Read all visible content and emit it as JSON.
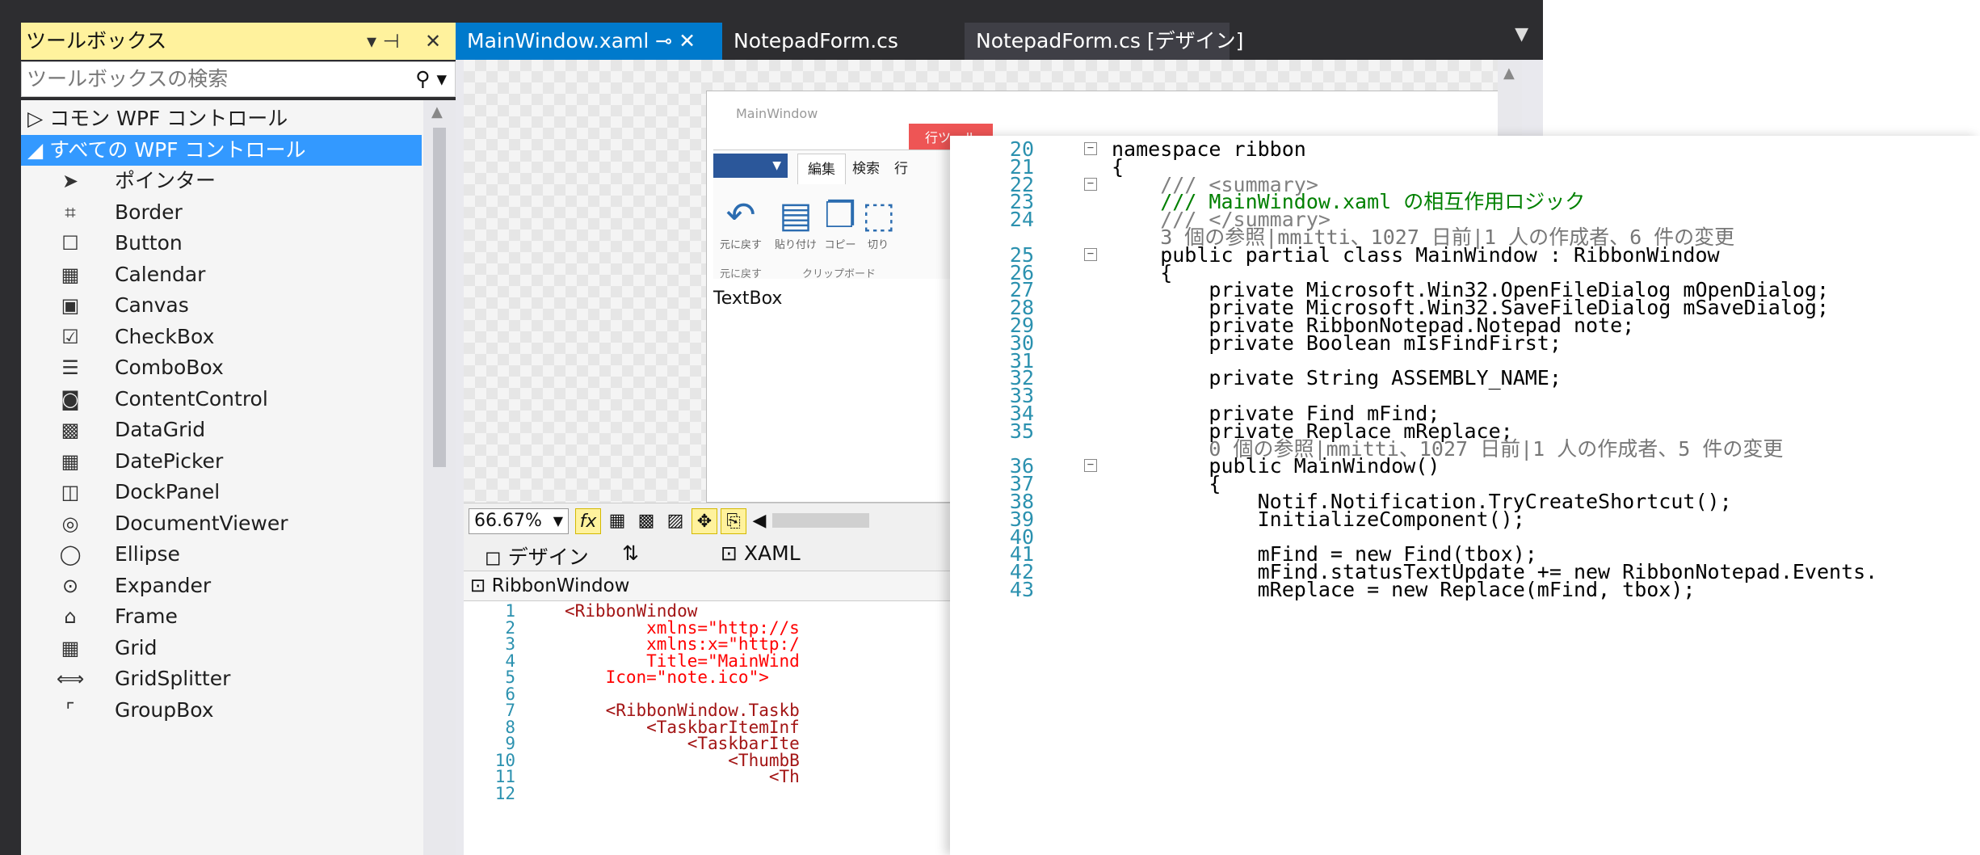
{
  "toolbox": {
    "title": "ツールボックス",
    "pin": "▾ 𝟏",
    "close": "✕",
    "search_placeholder": "ツールボックスの検索",
    "items": [
      {
        "label": "▷ コモン WPF コントロール",
        "icon": "",
        "category": true
      },
      {
        "label": "◢ すべての WPF コントロール",
        "icon": "",
        "category": true,
        "selected": true
      },
      {
        "label": "ポインター",
        "icon": "pointer-icon"
      },
      {
        "label": "Border",
        "icon": "border-icon"
      },
      {
        "label": "Button",
        "icon": "button-icon"
      },
      {
        "label": "Calendar",
        "icon": "calendar-icon"
      },
      {
        "label": "Canvas",
        "icon": "canvas-icon"
      },
      {
        "label": "CheckBox",
        "icon": "checkbox-icon"
      },
      {
        "label": "ComboBox",
        "icon": "combobox-icon"
      },
      {
        "label": "ContentControl",
        "icon": "contentcontrol-icon"
      },
      {
        "label": "DataGrid",
        "icon": "datagrid-icon"
      },
      {
        "label": "DatePicker",
        "icon": "datepicker-icon"
      },
      {
        "label": "DockPanel",
        "icon": "dockpanel-icon"
      },
      {
        "label": "DocumentViewer",
        "icon": "documentviewer-icon"
      },
      {
        "label": "Ellipse",
        "icon": "ellipse-icon"
      },
      {
        "label": "Expander",
        "icon": "expander-icon"
      },
      {
        "label": "Frame",
        "icon": "frame-icon"
      },
      {
        "label": "Grid",
        "icon": "grid-icon"
      },
      {
        "label": "GridSplitter",
        "icon": "gridsplitter-icon"
      },
      {
        "label": "GroupBox",
        "icon": "groupbox-icon"
      }
    ]
  },
  "tabs": [
    {
      "label": "MainWindow.xaml  ⊸  ✕",
      "active": true
    },
    {
      "label": "NotepadForm.cs"
    },
    {
      "label": "NotepadForm.cs [デザイン]"
    }
  ],
  "designer": {
    "window_title": "MainWindow",
    "context_tab": "行ツール",
    "ribbon_tabs": [
      "編集",
      "検索",
      "行"
    ],
    "buttons": [
      {
        "label": "元に戻す",
        "icon": "undo-icon"
      },
      {
        "label": "貼り付け",
        "icon": "paste-icon"
      },
      {
        "label": "コピー",
        "icon": "copy-icon"
      },
      {
        "label": "切り",
        "icon": "cut-icon"
      }
    ],
    "groups": [
      "元に戻す",
      "クリップボード"
    ],
    "textbox_label": "TextBox",
    "zoom": "66.67%",
    "split_tabs": {
      "design": "◻ デザイン",
      "swap": "⇅",
      "xaml": "⊡ XAML"
    },
    "breadcrumb": "⊡ RibbonWindow"
  },
  "xaml": [
    {
      "n": "1",
      "code": "<RibbonWindow"
    },
    {
      "n": "2",
      "code": "        xmlns=\"http://s"
    },
    {
      "n": "3",
      "code": "        xmlns:x=\"http:/"
    },
    {
      "n": "4",
      "code": "        Title=\"MainWind"
    },
    {
      "n": "5",
      "code": "    Icon=\"note.ico\">"
    },
    {
      "n": "6",
      "code": ""
    },
    {
      "n": "7",
      "code": "    <RibbonWindow.Taskb"
    },
    {
      "n": "8",
      "code": "        <TaskbarItemInf"
    },
    {
      "n": "9",
      "code": "            <TaskbarIte"
    },
    {
      "n": "10",
      "code": "                <ThumbB"
    },
    {
      "n": "11",
      "code": "                    <Th"
    },
    {
      "n": "12",
      "code": ""
    }
  ],
  "code": [
    {
      "n": "20",
      "code": "namespace ribbon",
      "fold": "⊟"
    },
    {
      "n": "21",
      "code": "{"
    },
    {
      "n": "22",
      "code": "    /// <summary>",
      "fold": "⊟"
    },
    {
      "n": "23",
      "code": "    /// MainWindow.xaml の相互作用ロジック"
    },
    {
      "n": "24",
      "code": "    /// </summary>"
    },
    {
      "n": "",
      "code": "    3 個の参照|mmitti、1027 日前|1 人の作成者、6 件の変更",
      "lens": true
    },
    {
      "n": "25",
      "code": "    public partial class MainWindow : RibbonWindow",
      "fold": "⊟"
    },
    {
      "n": "26",
      "code": "    {"
    },
    {
      "n": "27",
      "code": "        private Microsoft.Win32.OpenFileDialog mOpenDialog;"
    },
    {
      "n": "28",
      "code": "        private Microsoft.Win32.SaveFileDialog mSaveDialog;"
    },
    {
      "n": "29",
      "code": "        private RibbonNotepad.Notepad note;"
    },
    {
      "n": "30",
      "code": "        private Boolean mIsFindFirst;"
    },
    {
      "n": "31",
      "code": ""
    },
    {
      "n": "32",
      "code": "        private String ASSEMBLY_NAME;"
    },
    {
      "n": "33",
      "code": ""
    },
    {
      "n": "34",
      "code": "        private Find mFind;"
    },
    {
      "n": "35",
      "code": "        private Replace mReplace;"
    },
    {
      "n": "",
      "code": "        0 個の参照|mmitti、1027 日前|1 人の作成者、5 件の変更",
      "lens": true
    },
    {
      "n": "36",
      "code": "        public MainWindow()",
      "fold": "⊟"
    },
    {
      "n": "37",
      "code": "        {"
    },
    {
      "n": "38",
      "code": "            Notif.Notification.TryCreateShortcut();"
    },
    {
      "n": "39",
      "code": "            InitializeComponent();"
    },
    {
      "n": "40",
      "code": ""
    },
    {
      "n": "41",
      "code": "            mFind = new Find(tbox);"
    },
    {
      "n": "42",
      "code": "            mFind.statusTextUpdate += new RibbonNotepad.Events."
    },
    {
      "n": "43",
      "code": "            mReplace = new Replace(mFind, tbox);"
    }
  ]
}
